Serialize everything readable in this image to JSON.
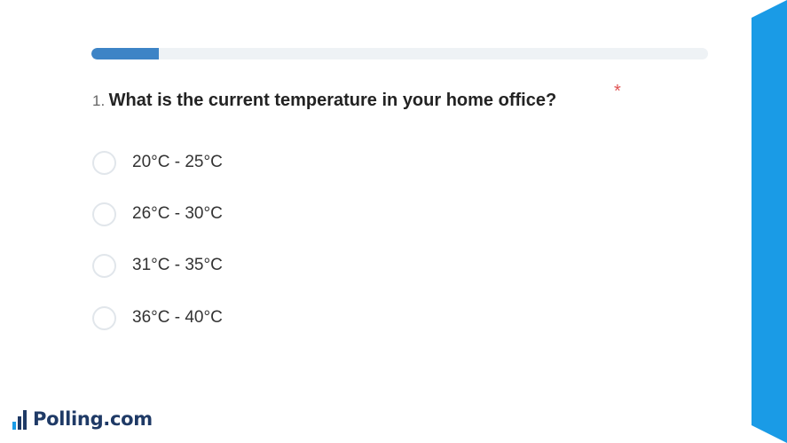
{
  "progress": {
    "fraction": 0.11
  },
  "question": {
    "number": "1.",
    "text": "What is the current temperature in your home office?",
    "required_marker": "*"
  },
  "options": [
    {
      "label": "20°C - 25°C",
      "selected": false
    },
    {
      "label": "26°C - 30°C",
      "selected": false
    },
    {
      "label": "31°C - 35°C",
      "selected": false
    },
    {
      "label": "36°C - 40°C",
      "selected": false
    }
  ],
  "brand": {
    "name": "Polling.com",
    "icon": "bar-chart-icon"
  },
  "colors": {
    "progress_fill": "#3d84c6",
    "accent_band": "#1a9be6",
    "required_star": "#e05454",
    "brand_text": "#1f3a66"
  }
}
